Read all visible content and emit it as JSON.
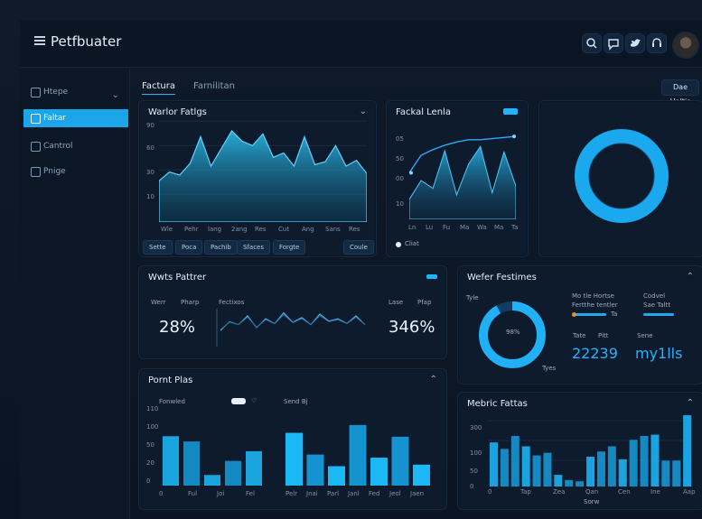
{
  "app": {
    "title": "Petfbuater"
  },
  "topbar": {
    "icons": [
      "search-icon",
      "chat-icon",
      "twitter-icon",
      "headset-icon"
    ]
  },
  "sidebar": {
    "items": [
      {
        "label": "Htepe",
        "icon": "clock-icon",
        "active": false,
        "chevron": true
      },
      {
        "label": "Faltar",
        "icon": "warning-icon",
        "active": true
      },
      {
        "label": "Cantrol",
        "icon": "grid-icon",
        "active": false
      },
      {
        "label": "Pnige",
        "icon": "person-icon",
        "active": false
      }
    ]
  },
  "tabs": [
    "Factura",
    "Farnilitan"
  ],
  "topright_button": "Dae Haltis",
  "cards": {
    "wave": {
      "title": "Warlor Fatlgs",
      "y_ticks": [
        "90",
        "60",
        "30",
        "10"
      ],
      "x_ticks": [
        "Wle",
        "Pehr",
        "lang",
        "2ang",
        "Res",
        "Cut",
        "Ang",
        "Sans",
        "Res"
      ],
      "pills": [
        "Sette",
        "Poca",
        "Pachib",
        "Sfaces",
        "Forgte"
      ],
      "right_pill": "Coule"
    },
    "line": {
      "title": "Fackal Lenla",
      "y_ticks": [
        "05",
        "50",
        "00",
        "10"
      ],
      "x_ticks": [
        "Ln",
        "Lu",
        "Fu",
        "Ma",
        "Wa",
        "Ma",
        "Ta"
      ],
      "legend": "Cliat"
    },
    "kpi": {
      "title": "Wwts Pattrer",
      "left_labels": [
        "Werr",
        "Pharp"
      ],
      "center_label": "Fectixos",
      "right_labels": [
        "Lase",
        "Pfap"
      ],
      "left_value": "28%",
      "right_value": "346%"
    },
    "donutcard": {
      "title": "Wefer Festimes",
      "center_small": "98%",
      "ticks": [
        "Tyle",
        "Tyes"
      ],
      "top_left": "Mo tle Hortse",
      "top_left_sub": "Fertthe tentler",
      "top_left_tag": "Ta",
      "top_right": "Codvel",
      "top_right_sub": "Sae Taltt",
      "b1_label": "Tate",
      "b2_label": "Pitt",
      "b3_label": "Sene",
      "big_left": "22239",
      "big_right": "my1lls"
    },
    "barsL": {
      "title": "Pornt Plas",
      "sub_left": "Fonwled",
      "sub_right": "Send Bj",
      "y_ticks": [
        "110",
        "100",
        "50",
        "20",
        "0"
      ],
      "xL": [
        "0",
        "Ful",
        "Joi",
        "Fel"
      ],
      "xR": [
        "Pelr",
        "Jnai",
        "Parl",
        "Janl",
        "Fed",
        "Jeol",
        "Jaen"
      ]
    },
    "barsR": {
      "title": "Mebric Fattas",
      "y_ticks": [
        "300",
        "100",
        "50",
        "0"
      ],
      "x": [
        "0",
        "Tap",
        "Zea",
        "Qan",
        "Cen",
        "Ine",
        "Aap"
      ],
      "footer": "Sorw"
    }
  },
  "chart_data": [
    {
      "type": "area",
      "title": "Warlor Fatlgs",
      "x": [
        "Wle",
        "Pehr",
        "lang",
        "2ang",
        "Res",
        "Cut",
        "Ang",
        "Sans",
        "Res"
      ],
      "values": [
        28,
        34,
        32,
        40,
        58,
        38,
        50,
        62,
        55,
        52,
        60,
        44,
        47,
        38,
        58,
        39,
        41,
        52,
        38,
        42,
        33
      ]
    },
    {
      "type": "line",
      "title": "Fackal Lenla",
      "x": [
        "Ln",
        "Lu",
        "Fu",
        "Ma",
        "Wa",
        "Ma",
        "Ta"
      ],
      "series": [
        {
          "values": [
            42,
            58,
            63,
            67,
            70,
            72,
            72,
            73,
            74,
            75
          ]
        },
        {
          "values": [
            18,
            35,
            28,
            62,
            22,
            50,
            66,
            24,
            61,
            30
          ]
        }
      ]
    },
    {
      "type": "pie",
      "title": "",
      "values": [
        100
      ]
    },
    {
      "type": "line",
      "title": "Wwts Pattrer",
      "values": [
        30,
        45,
        40,
        55,
        35,
        50,
        42,
        60,
        44,
        52,
        40,
        58,
        46,
        50,
        42,
        55,
        40
      ]
    },
    {
      "type": "pie",
      "title": "Wefer Festimes",
      "values": [
        92,
        8
      ]
    },
    {
      "type": "bar",
      "title": "Pornt Plas",
      "values": [
        56,
        50,
        12,
        28,
        39
      ]
    },
    {
      "type": "bar",
      "title": "",
      "values": [
        68,
        40,
        25,
        78,
        36,
        63,
        27
      ]
    },
    {
      "type": "bar",
      "title": "Mebric Fattas",
      "values": [
        68,
        58,
        78,
        62,
        48,
        52,
        18,
        10,
        8,
        46,
        54,
        62,
        42,
        72,
        78,
        80,
        40,
        40,
        110
      ]
    }
  ]
}
